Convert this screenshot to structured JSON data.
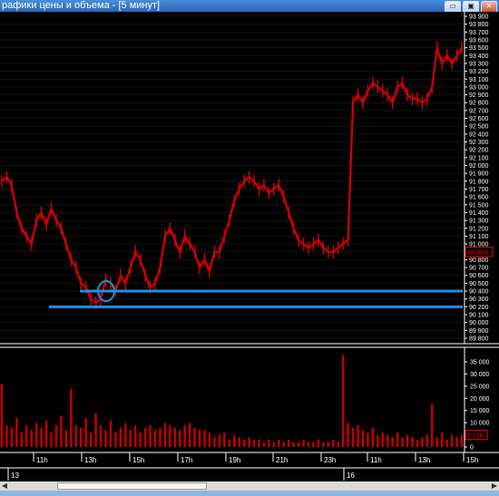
{
  "window": {
    "title": "рафики цены и объема - [5 минут]",
    "buttons": [
      {
        "name": "minimize-button",
        "icon": "minimize-icon",
        "glyph": "▭"
      },
      {
        "name": "restore-button",
        "icon": "restore-icon",
        "glyph": "▣"
      },
      {
        "name": "close-button",
        "icon": "close-icon",
        "glyph": "✕"
      }
    ]
  },
  "colors": {
    "background": "#000000",
    "price": "#d40000",
    "volume": "#c00000",
    "support_lines": "#1e90e0",
    "grid": "#2a2a2a",
    "axis_text": "#ffffff",
    "price_marker_bg": "#ff0000"
  },
  "price_panel": {
    "y_ticks": [
      "93 900",
      "93 800",
      "93 700",
      "93 600",
      "93 500",
      "93 400",
      "93 300",
      "93 200",
      "93 100",
      "93 000",
      "92 900",
      "92 800",
      "92 700",
      "92 600",
      "92 500",
      "92 400",
      "92 300",
      "92 200",
      "92 100",
      "92 000",
      "91 900",
      "91 800",
      "91 700",
      "91 600",
      "91 500",
      "91 400",
      "91 300",
      "91 200",
      "91 100",
      "91 000",
      "90 900",
      "90 800",
      "90 700",
      "90 600",
      "90 500",
      "90 400",
      "90 300",
      "90 200",
      "90 100",
      "90 000",
      "89 900",
      "89 800"
    ],
    "last_price_label": "90 800"
  },
  "volume_panel": {
    "y_ticks": [
      "35 000",
      "30 000",
      "25 000",
      "20 000",
      "15 000",
      "10 000",
      "5 000",
      "0"
    ],
    "last_volume_label": "5 136"
  },
  "time_axis": {
    "hour_labels": [
      "11h",
      "13h",
      "15h",
      "17h",
      "19h",
      "21h",
      "23h",
      "11h",
      "13h",
      "15h"
    ],
    "date_labels": [
      "13",
      "16"
    ]
  },
  "chart_data": {
    "type": "line",
    "title": "",
    "series": [
      {
        "values": [
          91800,
          91850,
          91750,
          91400,
          91200,
          91100,
          91000,
          91300,
          91400,
          91250,
          91450,
          91300,
          91200,
          91000,
          90800,
          90700,
          90500,
          90450,
          90300,
          90250,
          90300,
          90550,
          90500,
          90400,
          90600,
          90500,
          90700,
          90900,
          90800,
          90600,
          90450,
          90500,
          90700,
          91100,
          91200,
          91050,
          90900,
          91100,
          91000,
          90900,
          90700,
          90800,
          90650,
          90900,
          90900,
          91100,
          91300,
          91550,
          91700,
          91800,
          91850,
          91800,
          91700,
          91750,
          91650,
          91700,
          91750,
          91600,
          91400,
          91200,
          91050,
          91000,
          90950,
          91000,
          91050,
          90950,
          90900,
          90900,
          90950,
          91000,
          91050,
          92800,
          92900,
          92800,
          92950,
          93050,
          93000,
          92950,
          92900,
          92800,
          93000,
          93050,
          92900,
          92850,
          92850,
          92800,
          92850,
          93000,
          93500,
          93300,
          93400,
          93300,
          93400,
          93500
        ]
      }
    ],
    "volume": [
      26000,
      9000,
      8000,
      12000,
      6000,
      9000,
      7000,
      10000,
      8000,
      11000,
      6000,
      9000,
      13000,
      7000,
      24000,
      9000,
      8000,
      12000,
      6000,
      14000,
      9000,
      7000,
      11000,
      6000,
      8000,
      10000,
      7000,
      9000,
      6000,
      8000,
      9000,
      7000,
      8000,
      10000,
      9000,
      8000,
      7000,
      9000,
      10000,
      8000,
      7000,
      7000,
      6000,
      4000,
      5000,
      6000,
      3000,
      5000,
      4000,
      3000,
      4000,
      3000,
      3000,
      2000,
      3000,
      2000,
      3000,
      2000,
      3000,
      2000,
      2000,
      3000,
      2000,
      2000,
      3000,
      2000,
      2000,
      3000,
      2000,
      38000,
      10000,
      8000,
      9000,
      7000,
      6000,
      8000,
      5000,
      6000,
      5000,
      4000,
      6000,
      4000,
      5000,
      4000,
      3000,
      4000,
      5000,
      18000,
      4000,
      6000,
      3000,
      5000,
      4000,
      5000
    ],
    "support_levels": [
      90400,
      90200
    ],
    "ylim": [
      89800,
      93900
    ],
    "volume_ylim": [
      0,
      38000
    ]
  }
}
